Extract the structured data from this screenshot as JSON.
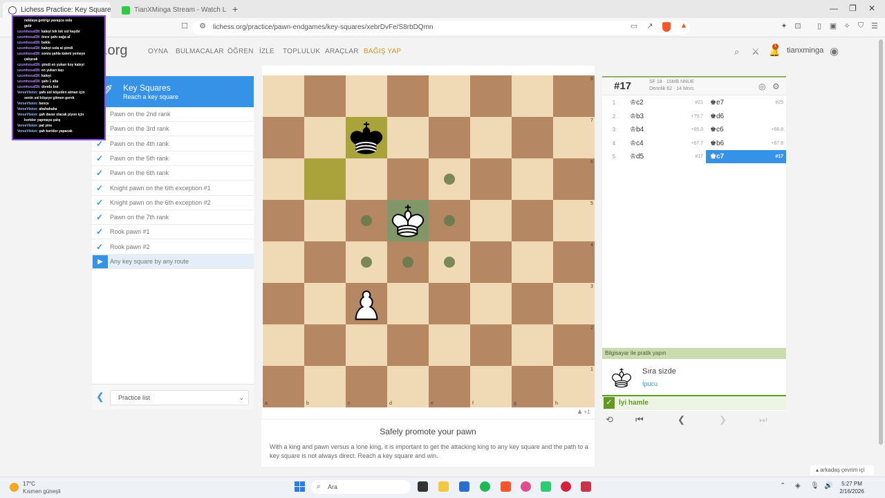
{
  "browser": {
    "tabs": [
      {
        "title": "Lichess Practice: Key Squares",
        "active": true
      },
      {
        "title": "TianXMinga Stream - Watch Live on",
        "active": false
      }
    ],
    "url": "lichess.org/practice/pawn-endgames/key-squares/xebrDvFe/S8rbDQmn",
    "brave_badge": "2"
  },
  "site": {
    "logo": "s.org",
    "nav": [
      "OYNA",
      "BULMACALAR",
      "ÖĞREN",
      "İZLE",
      "TOPLULUK",
      "ARAÇLAR"
    ],
    "donate": "BAĞIŞ YAP",
    "notif_count": "1",
    "username": "tianxminga"
  },
  "chat": [
    {
      "user": "",
      "text": "noktaya getirigi yavaşca sola"
    },
    {
      "user": "",
      "text": "getir"
    },
    {
      "user": "uzumhosaf28:",
      "text": "kaleyi tek tek sol kaydır"
    },
    {
      "user": "uzumhosaf28:",
      "text": "önce şahı sağa al"
    },
    {
      "user": "uzumhosaf28:",
      "text": "bekle"
    },
    {
      "user": "uzumhosaf28:",
      "text": "kaleyi sola al şimdi"
    },
    {
      "user": "uzumhosaf28:",
      "text": "sonra şahla kaleni yemeye"
    },
    {
      "user": "",
      "text": "çalışcak"
    },
    {
      "user": "uzumhosaf28:",
      "text": "şimdi en yukarı koy kaleyi"
    },
    {
      "user": "uzumhosaf28:",
      "text": "en yukarı taşı"
    },
    {
      "user": "uzumhosaf28:",
      "text": "kaleyi"
    },
    {
      "user": "uzumhosaf28:",
      "text": "şahı 1 alta"
    },
    {
      "user": "uzumhosaf28:",
      "text": "dondu bot"
    },
    {
      "user": "VerseVision:",
      "text": "şahı sol köşeden atman için"
    },
    {
      "user": "",
      "text": "senin sol köşeye gitmen gerek"
    },
    {
      "user": "VerseVision:",
      "text": "bence"
    },
    {
      "user": "VerseVision:",
      "text": "ahahahaha"
    },
    {
      "user": "VerseVision:",
      "text": "şah davar olacak piyon için"
    },
    {
      "user": "",
      "text": "koridor yapmaya çalış"
    },
    {
      "user": "VerseVision:",
      "text": "pat yine"
    },
    {
      "user": "VerseVision:",
      "text": "şah koridor yapacak"
    }
  ],
  "practice": {
    "title": "Key Squares",
    "subtitle": "Reach a key square",
    "items": [
      {
        "label": "Pawn on the 2nd rank",
        "done": false
      },
      {
        "label": "Pawn on the 3rd rank",
        "done": false
      },
      {
        "label": "Pawn on the 4th rank",
        "done": true
      },
      {
        "label": "Pawn on the 5th rank",
        "done": true
      },
      {
        "label": "Pawn on the 6th rank",
        "done": true
      },
      {
        "label": "Knight pawn on the 6th exception #1",
        "done": true
      },
      {
        "label": "Knight pawn on the 6th exception #2",
        "done": true
      },
      {
        "label": "Pawn on the 7th rank",
        "done": true
      },
      {
        "label": "Rook pawn #1",
        "done": true
      },
      {
        "label": "Rook pawn #2",
        "done": true
      },
      {
        "label": "Any key square by any route",
        "done": false,
        "active": true
      }
    ],
    "list_select": "Practice list"
  },
  "board": {
    "pieces": [
      {
        "square": "c7",
        "piece": "black-king"
      },
      {
        "square": "d5",
        "piece": "white-king"
      },
      {
        "square": "c3",
        "piece": "white-pawn"
      }
    ],
    "last_move": [
      "b6",
      "c7"
    ],
    "selected": "d5",
    "move_dots": [
      "e6",
      "c5",
      "e5",
      "c4",
      "d4",
      "e4"
    ],
    "files": [
      "a",
      "b",
      "c",
      "d",
      "e",
      "f",
      "g",
      "h"
    ],
    "ranks": [
      "8",
      "7",
      "6",
      "5",
      "4",
      "3",
      "2",
      "1"
    ],
    "footer": "+1"
  },
  "goal": {
    "title": "Safely promote your pawn",
    "text": "With a king and pawn versus a lone king, it is important to get the attacking king to any key square and the path to a key square is not always direct. Reach a key square and win."
  },
  "analysis": {
    "eval": "#17",
    "engine": "SF 18 · 15MB NNUE",
    "depth": "Derinlik 62 · 14 Mn/s",
    "moves": [
      {
        "num": "1",
        "white": "♔c2",
        "white_eval": "#21",
        "black": "♚e7",
        "black_eval": "#25"
      },
      {
        "num": "2",
        "white": "♔b3",
        "white_eval": "+79.7",
        "black": "♚d6",
        "black_eval": ""
      },
      {
        "num": "3",
        "white": "♔b4",
        "white_eval": "+65.3",
        "black": "♚c6",
        "black_eval": "+68.8"
      },
      {
        "num": "4",
        "white": "♔c4",
        "white_eval": "+67.7",
        "black": "♚b6",
        "black_eval": "+67.8"
      },
      {
        "num": "5",
        "white": "♔d5",
        "white_eval": "#17",
        "black": "♚c7",
        "black_eval": "#17"
      }
    ],
    "practice_label": "Bilgisayar ile pratik yapın",
    "turn_text": "Sıra sizde",
    "hint": "İpucu",
    "good_move": "İyi hamle"
  },
  "friends": "arkadaş çevrim içi",
  "taskbar": {
    "temp": "17°C",
    "weather": "Kısmen güneşli",
    "search": "Ara",
    "time": "5:27 PM",
    "date": "2/16/2026"
  }
}
